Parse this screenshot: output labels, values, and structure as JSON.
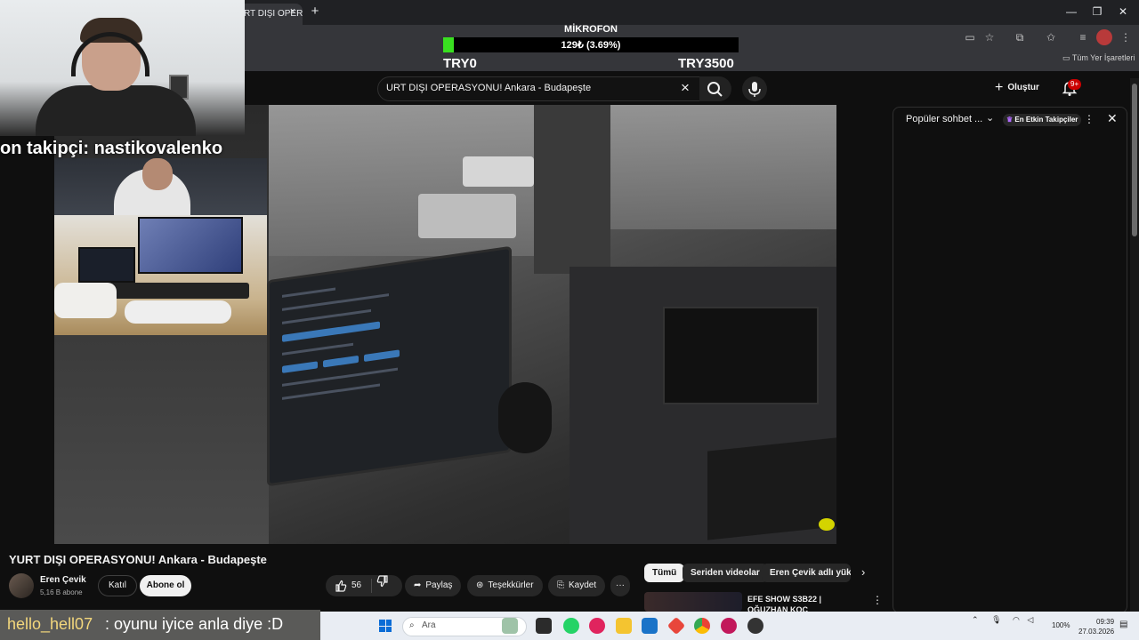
{
  "browser": {
    "tab_title": "RT DIŞI OPERASYONU! /",
    "tab_close": "×",
    "new_tab": "+",
    "window_controls": [
      "—",
      "❐",
      "✕"
    ],
    "bookmarks_all": "Tüm Yer İşaretleri"
  },
  "mic_overlay": {
    "title": "MİKROFON",
    "value_text": "129₺ (3.69%)",
    "progress_percent": 3.69,
    "min_label": "TRY0",
    "max_label": "TRY3500",
    "fill_color": "#39e020"
  },
  "youtube_header": {
    "search_value": "URT DIŞI OPERASYONU! Ankara - Budapeşte",
    "clear_icon": "×",
    "create_label": "Oluştur",
    "notification_badge": "9+"
  },
  "overlay": {
    "latest_follower": "on takipçi: nastikovalenko"
  },
  "chat_panel": {
    "title": "Popüler sohbet ...",
    "caret": "⌄",
    "top_fans": "En Etkin Takipçiler",
    "more": "⋮",
    "close": "✕"
  },
  "video_info": {
    "title": "YURT DIŞI OPERASYONU! Ankara - Budapeşte",
    "channel_name": "Eren Çevik",
    "subscribers": "5,16 B abone",
    "join_label": "Katıl",
    "subscribe_label": "Abone ol",
    "like_count": "56",
    "share_label": "Paylaş",
    "thanks_label": "Teşekkürler",
    "save_label": "Kaydet",
    "more_label": "···"
  },
  "chips": [
    "Tümü",
    "Seriden videolar",
    "Eren Çevik adlı yükle"
  ],
  "recommendation": {
    "title": "EFE SHOW S3B22 | OĞUZHAN KOÇ",
    "more": "⋮"
  },
  "chat_overlay": {
    "user": "hello_hell07",
    "message": ": oyunu iyice anla diye :D"
  },
  "taskbar": {
    "search_placeholder": "Ara",
    "battery": "100%",
    "time": "09:39",
    "date": "27.03.2026",
    "accent": "#0a6cd6"
  }
}
